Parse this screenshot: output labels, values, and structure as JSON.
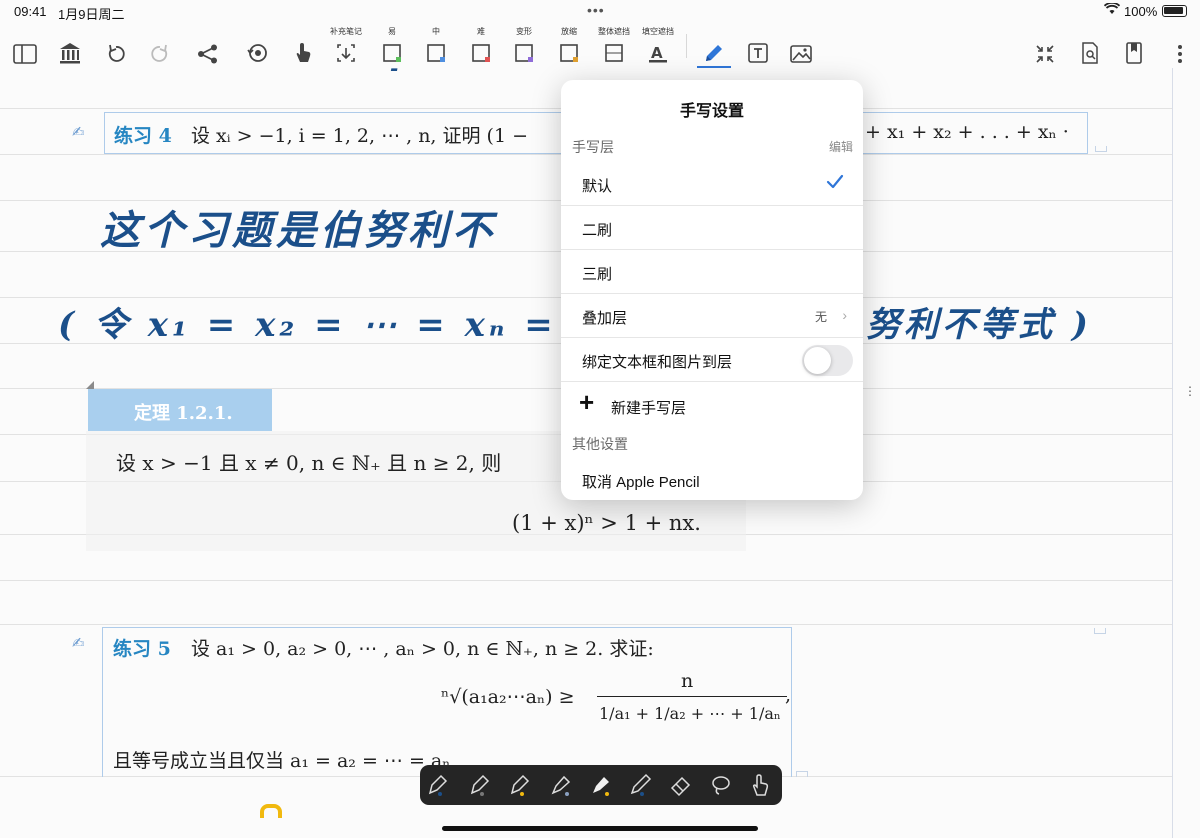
{
  "status_bar": {
    "time": "09:41",
    "date": "1月9日周二",
    "battery": "100%"
  },
  "toolbar": {
    "captions": {
      "supplement": "补充笔记",
      "easy": "易",
      "medium": "中",
      "hard": "难",
      "transform": "变形",
      "zoom": "放缩",
      "overall_mask": "整体遮挡",
      "fill_mask": "填空遮挡"
    }
  },
  "exercise4": {
    "label": "练习 4",
    "text": "设 xᵢ > −1, i = 1, 2, ⋯ , n, 证明 (1 −",
    "tail": "+ x₁ + x₂ + . . . + xₙ ·"
  },
  "handwriting": {
    "line1": "这个习题是伯努利不",
    "line2_left": "( 令 x₁ = x₂ = ⋯ = xₙ = x ,",
    "line2_right": "努利不等式 )"
  },
  "theorem": {
    "title": "定理  1.2.1.",
    "line1": "设 x > −1 且 x ≠ 0, n ∈ ℕ₊ 且 n ≥ 2, 则",
    "formula": "(1 + x)ⁿ > 1 + nx."
  },
  "exercise5": {
    "label": "练习 5",
    "text": "设 a₁ > 0, a₂ > 0, ⋯ , aₙ > 0, n ∈ ℕ₊, n ≥ 2. 求证:",
    "formula_left": "ⁿ√(a₁a₂⋯aₙ)  ≥",
    "formula_num": "n",
    "formula_den": "1/a₁ + 1/a₂ + ⋯ + 1/aₙ",
    "formula_comma": ",",
    "last_line": "且等号成立当且仅当 a₁ = a₂ = ⋯ = aₙ"
  },
  "popover": {
    "title": "手写设置",
    "section_layers": "手写层",
    "edit": "编辑",
    "layers": [
      "默认",
      "二刷",
      "三刷"
    ],
    "overlay_label": "叠加层",
    "overlay_value": "无",
    "bind_label": "绑定文本框和图片到层",
    "bind_on": false,
    "new_layer": "新建手写层",
    "section_other": "其他设置",
    "cancel_pencil": "取消 Apple Pencil"
  },
  "colors": {
    "accent": "#2f76d8",
    "ink": "#1b4f8a",
    "exercise_label": "#2686c2"
  }
}
